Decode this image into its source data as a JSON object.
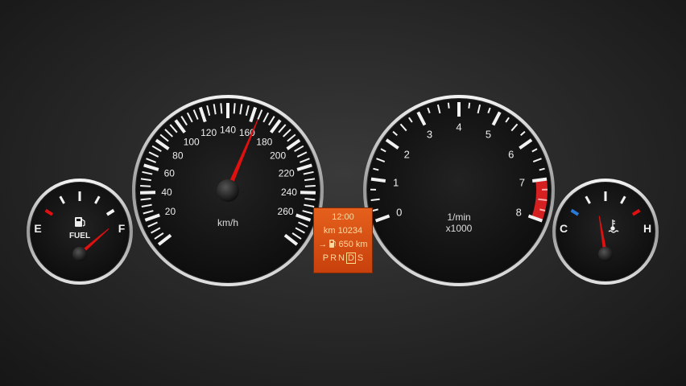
{
  "speedometer": {
    "labels": [
      "20",
      "40",
      "60",
      "80",
      "100",
      "120",
      "140",
      "160",
      "180",
      "200",
      "220",
      "240",
      "260"
    ],
    "unit": "km/h",
    "max": 280,
    "value": 165
  },
  "tachometer": {
    "labels": [
      "0",
      "1",
      "2",
      "3",
      "4",
      "5",
      "6",
      "7",
      "8"
    ],
    "unit_line1": "1/min",
    "unit_line2": "x1000",
    "max": 8,
    "redline_from": 7,
    "value": null
  },
  "fuel_gauge": {
    "empty_label": "E",
    "full_label": "F",
    "title": "FUEL",
    "level": 0.92
  },
  "temp_gauge": {
    "cold_label": "C",
    "hot_label": "H",
    "level": 0.42
  },
  "info_display": {
    "time": "12:00",
    "odometer": "km 10234",
    "range_arrow": "→",
    "range": "650 km",
    "gears": [
      "P",
      "R",
      "N",
      "D",
      "S"
    ],
    "selected_gear": "D"
  },
  "colors": {
    "needle": "#e01010",
    "redzone": "#d42020",
    "cold": "#2a7ad8",
    "display_bg": "#d2480f",
    "display_text": "#ffd9a0"
  }
}
